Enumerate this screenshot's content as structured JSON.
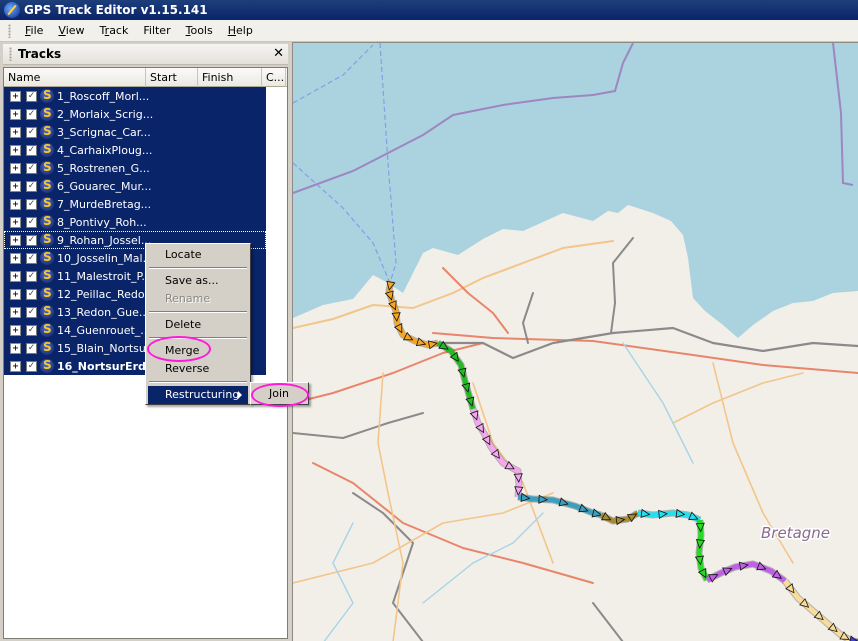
{
  "window": {
    "title": "GPS Track Editor v1.15.141"
  },
  "menubar": {
    "items": [
      {
        "label": "File",
        "accel": "F",
        "rest": "ile"
      },
      {
        "label": "View",
        "accel": "V",
        "rest": "iew"
      },
      {
        "label": "Track",
        "pre": "T",
        "accel": "r",
        "rest": "ack"
      },
      {
        "label": "Filter",
        "accel": "",
        "rest": "Filter"
      },
      {
        "label": "Tools",
        "accel": "T",
        "rest": "ools"
      },
      {
        "label": "Help",
        "accel": "H",
        "rest": "elp"
      }
    ]
  },
  "tracks_panel": {
    "title": "Tracks",
    "close_glyph": "✕",
    "columns": [
      "Name",
      "Start",
      "Finish",
      "C..."
    ],
    "rows": [
      {
        "label": "1_Roscoff_Morl...",
        "checked": true,
        "expander": "+"
      },
      {
        "label": "2_Morlaix_Scrig...",
        "checked": true,
        "expander": "+"
      },
      {
        "label": "3_Scrignac_Car...",
        "checked": true,
        "expander": "+"
      },
      {
        "label": "4_CarhaixPloug...",
        "checked": true,
        "expander": "+"
      },
      {
        "label": "5_Rostrenen_G...",
        "checked": true,
        "expander": "+"
      },
      {
        "label": "6_Gouarec_Mur...",
        "checked": true,
        "expander": "+"
      },
      {
        "label": "7_MurdeBretag...",
        "checked": true,
        "expander": "+"
      },
      {
        "label": "8_Pontivy_Roh...",
        "checked": true,
        "expander": "+"
      },
      {
        "label": "9_Rohan_Jossel...",
        "checked": true,
        "expander": "+",
        "focused": true
      },
      {
        "label": "10_Josselin_Mal...",
        "checked": true,
        "expander": "+"
      },
      {
        "label": "11_Malestroit_P...",
        "checked": true,
        "expander": "+"
      },
      {
        "label": "12_Peillac_Redo...",
        "checked": true,
        "expander": "+"
      },
      {
        "label": "13_Redon_Gue...",
        "checked": true,
        "expander": "+"
      },
      {
        "label": "14_Guenrouet_...",
        "checked": true,
        "expander": "+"
      },
      {
        "label": "15_Blain_Nortsu...",
        "checked": true,
        "expander": "+"
      },
      {
        "label": "16_NortsurErd...",
        "checked": true,
        "expander": "+",
        "bold": true
      }
    ]
  },
  "context_menu": {
    "items": {
      "locate": "Locate",
      "save_as": "Save as...",
      "rename": "Rename",
      "delete": "Delete",
      "merge": "Merge",
      "reverse": "Reverse",
      "restructuring": "Restructuring"
    },
    "disabled": [
      "rename"
    ],
    "selected": "restructuring",
    "submenu": {
      "join": "Join"
    },
    "highlighted_items": [
      "merge",
      "join"
    ],
    "highlight_color": "#ff1ad9"
  },
  "map": {
    "region_label": "Bretagne",
    "colors": {
      "sea": "#aad3df",
      "land": "#f2efe9",
      "boundary": "#9e86c0"
    },
    "track_segments": [
      {
        "track": "1_Roscoff_Morl...",
        "color": "#f5a623"
      },
      {
        "track": "2_Morlaix_Scrig...",
        "color": "#22bb22"
      },
      {
        "track": "3_Scrignac_Car...",
        "color": "#f4a6f0"
      },
      {
        "track": "4_CarhaixPloug...",
        "color": "#3aa0c0"
      },
      {
        "track": "5_Rostrenen_G...",
        "color": "#a88a30"
      },
      {
        "track": "6_Gouarec_Mur...",
        "color": "#22e0f0"
      },
      {
        "track": "7_MurdeBretag...",
        "color": "#22dd22"
      },
      {
        "track": "8_Pontivy_Roh...",
        "color": "#c060e8"
      },
      {
        "track": "9_Rohan_Jossel...",
        "color": "#f8dc98"
      },
      {
        "track": "10_Josselin_Mal...",
        "color": "#4040e0"
      }
    ]
  }
}
